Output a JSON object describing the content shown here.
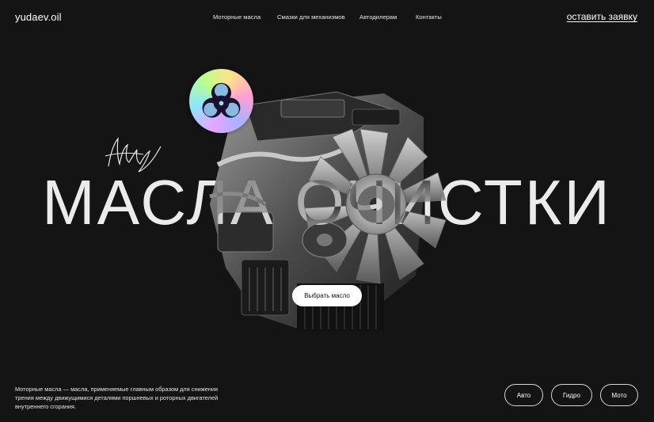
{
  "header": {
    "logo": "yudaev.oil",
    "nav": [
      "Моторные масла",
      "Смазки для механизмов",
      "Автодилерам",
      "Контакты"
    ],
    "cta": "оставить заявку"
  },
  "hero": {
    "headline": "МАСЛА ОЧИСТКИ",
    "button": "Выбрать масло",
    "badge_icon": "biohazard-icon",
    "image": "engine-illustration"
  },
  "footer": {
    "description": "Моторные масла — масла, применяемые главным образом для снижения трения между движущимися деталями поршневых и роторных двигателей внутреннего сгорания.",
    "categories": [
      "Авто",
      "Гидро",
      "Мото"
    ]
  },
  "colors": {
    "background": "#141414",
    "text": "#ffffff",
    "button_bg": "#ffffff",
    "button_text": "#111111"
  }
}
